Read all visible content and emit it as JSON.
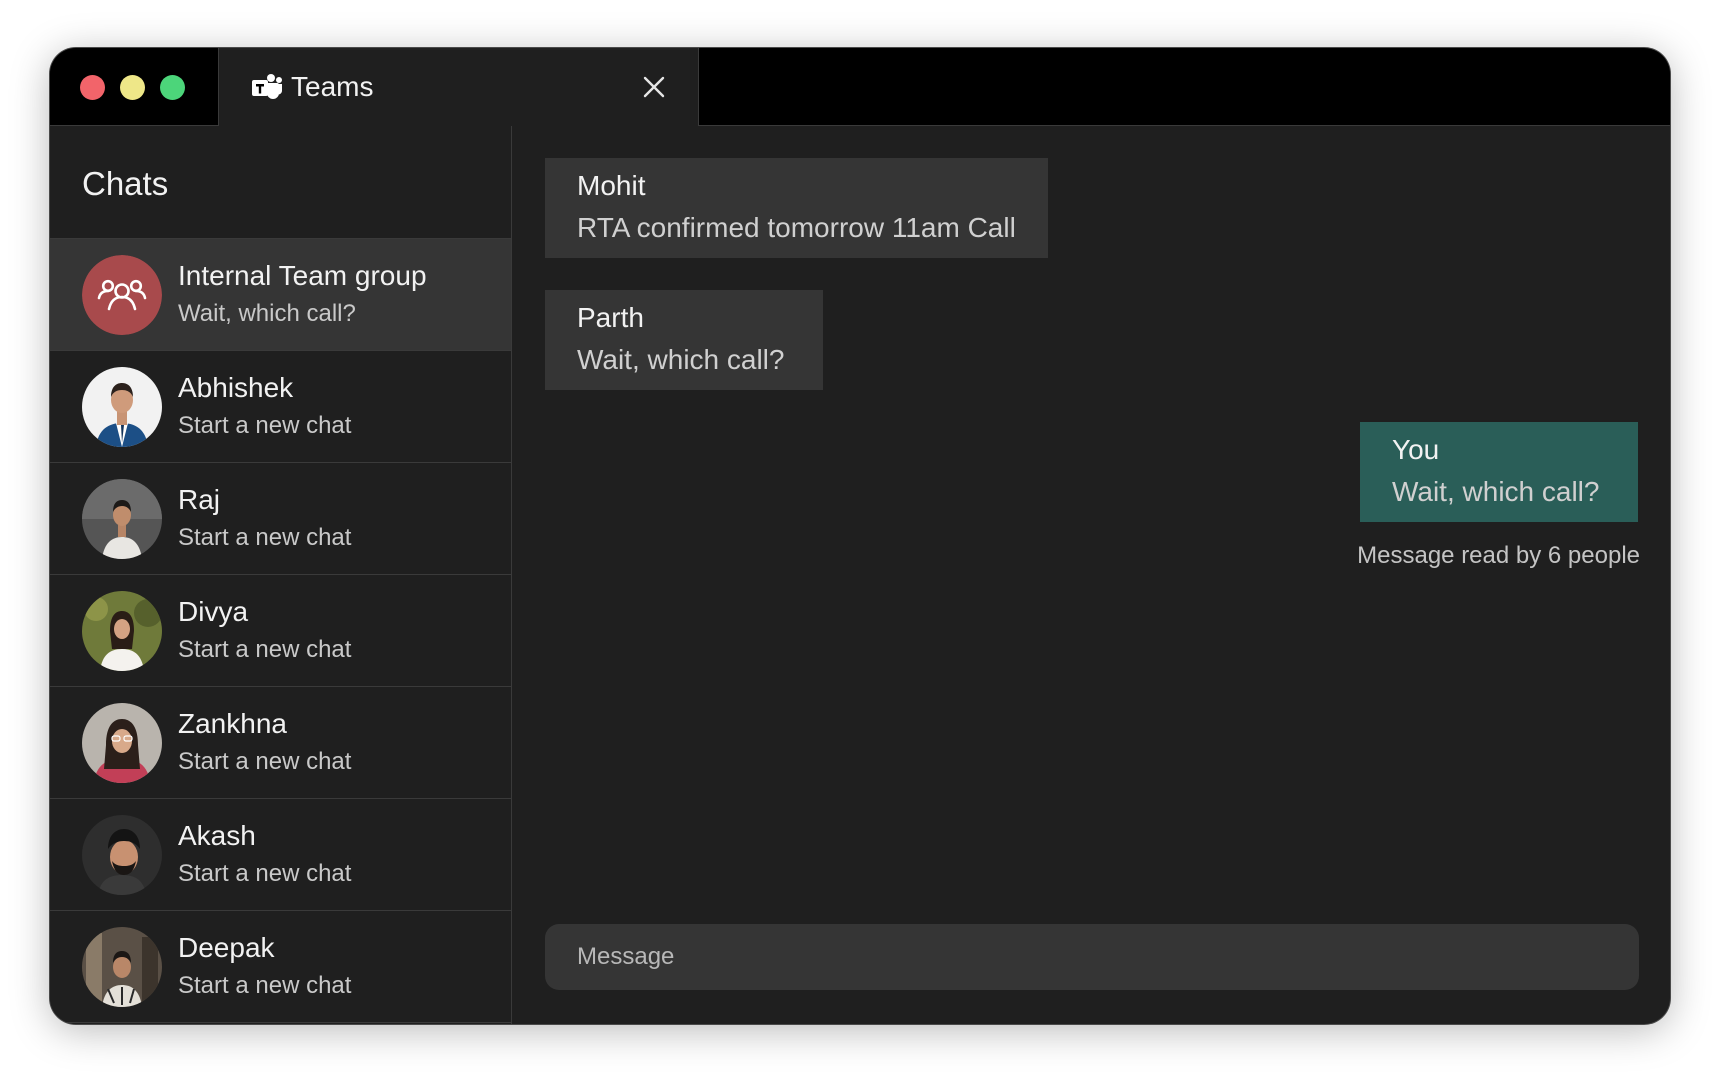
{
  "window": {
    "tab_title": "Teams",
    "tab_icon": "teams-icon",
    "close_icon": "close-icon"
  },
  "sidebar": {
    "title": "Chats",
    "chats": [
      {
        "name": "Internal Team group",
        "preview": "Wait, which call?",
        "avatar": "group-icon",
        "active": true
      },
      {
        "name": "Abhishek",
        "preview": "Start a new chat",
        "avatar": "photo"
      },
      {
        "name": "Raj",
        "preview": "Start a new chat",
        "avatar": "photo"
      },
      {
        "name": "Divya",
        "preview": "Start a new chat",
        "avatar": "photo"
      },
      {
        "name": "Zankhna",
        "preview": "Start a new chat",
        "avatar": "photo"
      },
      {
        "name": "Akash",
        "preview": "Start a new chat",
        "avatar": "photo"
      },
      {
        "name": "Deepak",
        "preview": "Start a new chat",
        "avatar": "photo"
      }
    ]
  },
  "conversation": {
    "messages": [
      {
        "sender": "Mohit",
        "text": "RTA confirmed tomorrow 11am Call",
        "mine": false
      },
      {
        "sender": "Parth",
        "text": "Wait, which call?",
        "mine": false
      },
      {
        "sender": "You",
        "text": "Wait, which call?",
        "mine": true
      }
    ],
    "read_receipt": "Message read by 6 people",
    "composer_placeholder": "Message"
  },
  "colors": {
    "window_bg": "#1f1f1f",
    "titlebar_bg": "#000000",
    "active_item_bg": "#353535",
    "own_message_bg": "#2a5e58",
    "group_avatar_bg": "#a84a4c"
  }
}
